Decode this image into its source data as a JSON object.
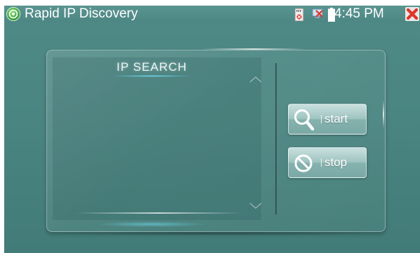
{
  "status_bar": {
    "app_title": "Rapid IP Discovery",
    "time": "4:45 PM",
    "icons": [
      "sd-card-icon",
      "network-error-icon",
      "battery-icon",
      "close-icon"
    ],
    "close_color": "#e0342a"
  },
  "panel": {
    "title": "IP SEARCH",
    "results": []
  },
  "buttons": {
    "start_label": "start",
    "stop_label": "stop"
  },
  "colors": {
    "background": "#4a8581",
    "glow": "#78e6ff"
  }
}
